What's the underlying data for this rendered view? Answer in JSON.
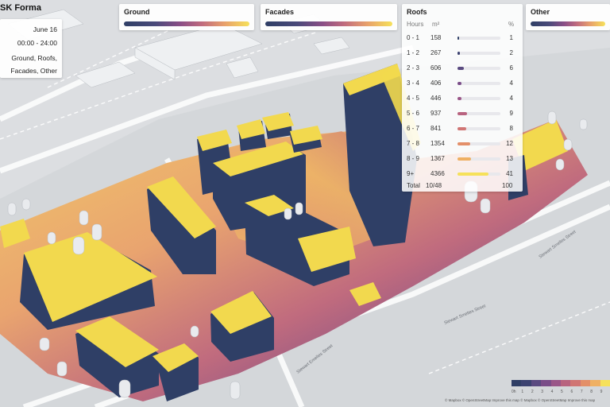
{
  "app": {
    "brand": "SK Forma"
  },
  "info": {
    "date": "June 16",
    "time_range": "00:00 - 24:00",
    "surfaces_line1": "Ground, Roofs,",
    "surfaces_line2": "Facades, Other"
  },
  "legends": [
    {
      "label": "Ground"
    },
    {
      "label": "Facades"
    },
    {
      "label": "Other"
    }
  ],
  "roofs": {
    "title": "Roofs",
    "col_hours": "Hours",
    "col_area": "m²",
    "col_pct": "%",
    "rows": [
      {
        "hours": "0 - 1",
        "area": "158",
        "pct": "1",
        "fraction": 0.04,
        "color": "#2f3f66"
      },
      {
        "hours": "1 - 2",
        "area": "267",
        "pct": "2",
        "fraction": 0.06,
        "color": "#3b4270"
      },
      {
        "hours": "2 - 3",
        "area": "606",
        "pct": "6",
        "fraction": 0.14,
        "color": "#5a4a80"
      },
      {
        "hours": "3 - 4",
        "area": "406",
        "pct": "4",
        "fraction": 0.1,
        "color": "#7a4d88"
      },
      {
        "hours": "4 - 5",
        "area": "446",
        "pct": "4",
        "fraction": 0.1,
        "color": "#9a5688"
      },
      {
        "hours": "5 - 6",
        "area": "937",
        "pct": "9",
        "fraction": 0.22,
        "color": "#b8637f"
      },
      {
        "hours": "6 - 7",
        "area": "841",
        "pct": "8",
        "fraction": 0.2,
        "color": "#d07574"
      },
      {
        "hours": "7 - 8",
        "area": "1354",
        "pct": "12",
        "fraction": 0.3,
        "color": "#e38f69"
      },
      {
        "hours": "8 - 9",
        "area": "1367",
        "pct": "13",
        "fraction": 0.32,
        "color": "#efb063"
      },
      {
        "hours": "9+",
        "area": "4366",
        "pct": "41",
        "fraction": 0.72,
        "color": "#f6e15a"
      }
    ],
    "total_label": "Total",
    "total_area": "10/48",
    "total_pct": "100"
  },
  "streets": [
    {
      "name": "Stewart Emelies Street"
    },
    {
      "name": "Stewart Smeltes Street"
    },
    {
      "name": "Stewart Smelles Street"
    }
  ],
  "scale": {
    "colors": [
      "#2f3f66",
      "#3b4270",
      "#5a4a80",
      "#7a4d88",
      "#9a5688",
      "#b8637f",
      "#d07574",
      "#e38f69",
      "#efb063",
      "#f6e15a"
    ],
    "labels": [
      "0h",
      "1",
      "2",
      "3",
      "4",
      "5",
      "6",
      "7",
      "8",
      "9"
    ]
  },
  "attribution": "© Mapbox © OpenStreetMap Improve this map © Mapbox © OpenStreetMap Improve this map",
  "colors": {
    "shadow": "#2f3f66",
    "sun": "#f2d94e",
    "ground": "#d9dbde"
  }
}
